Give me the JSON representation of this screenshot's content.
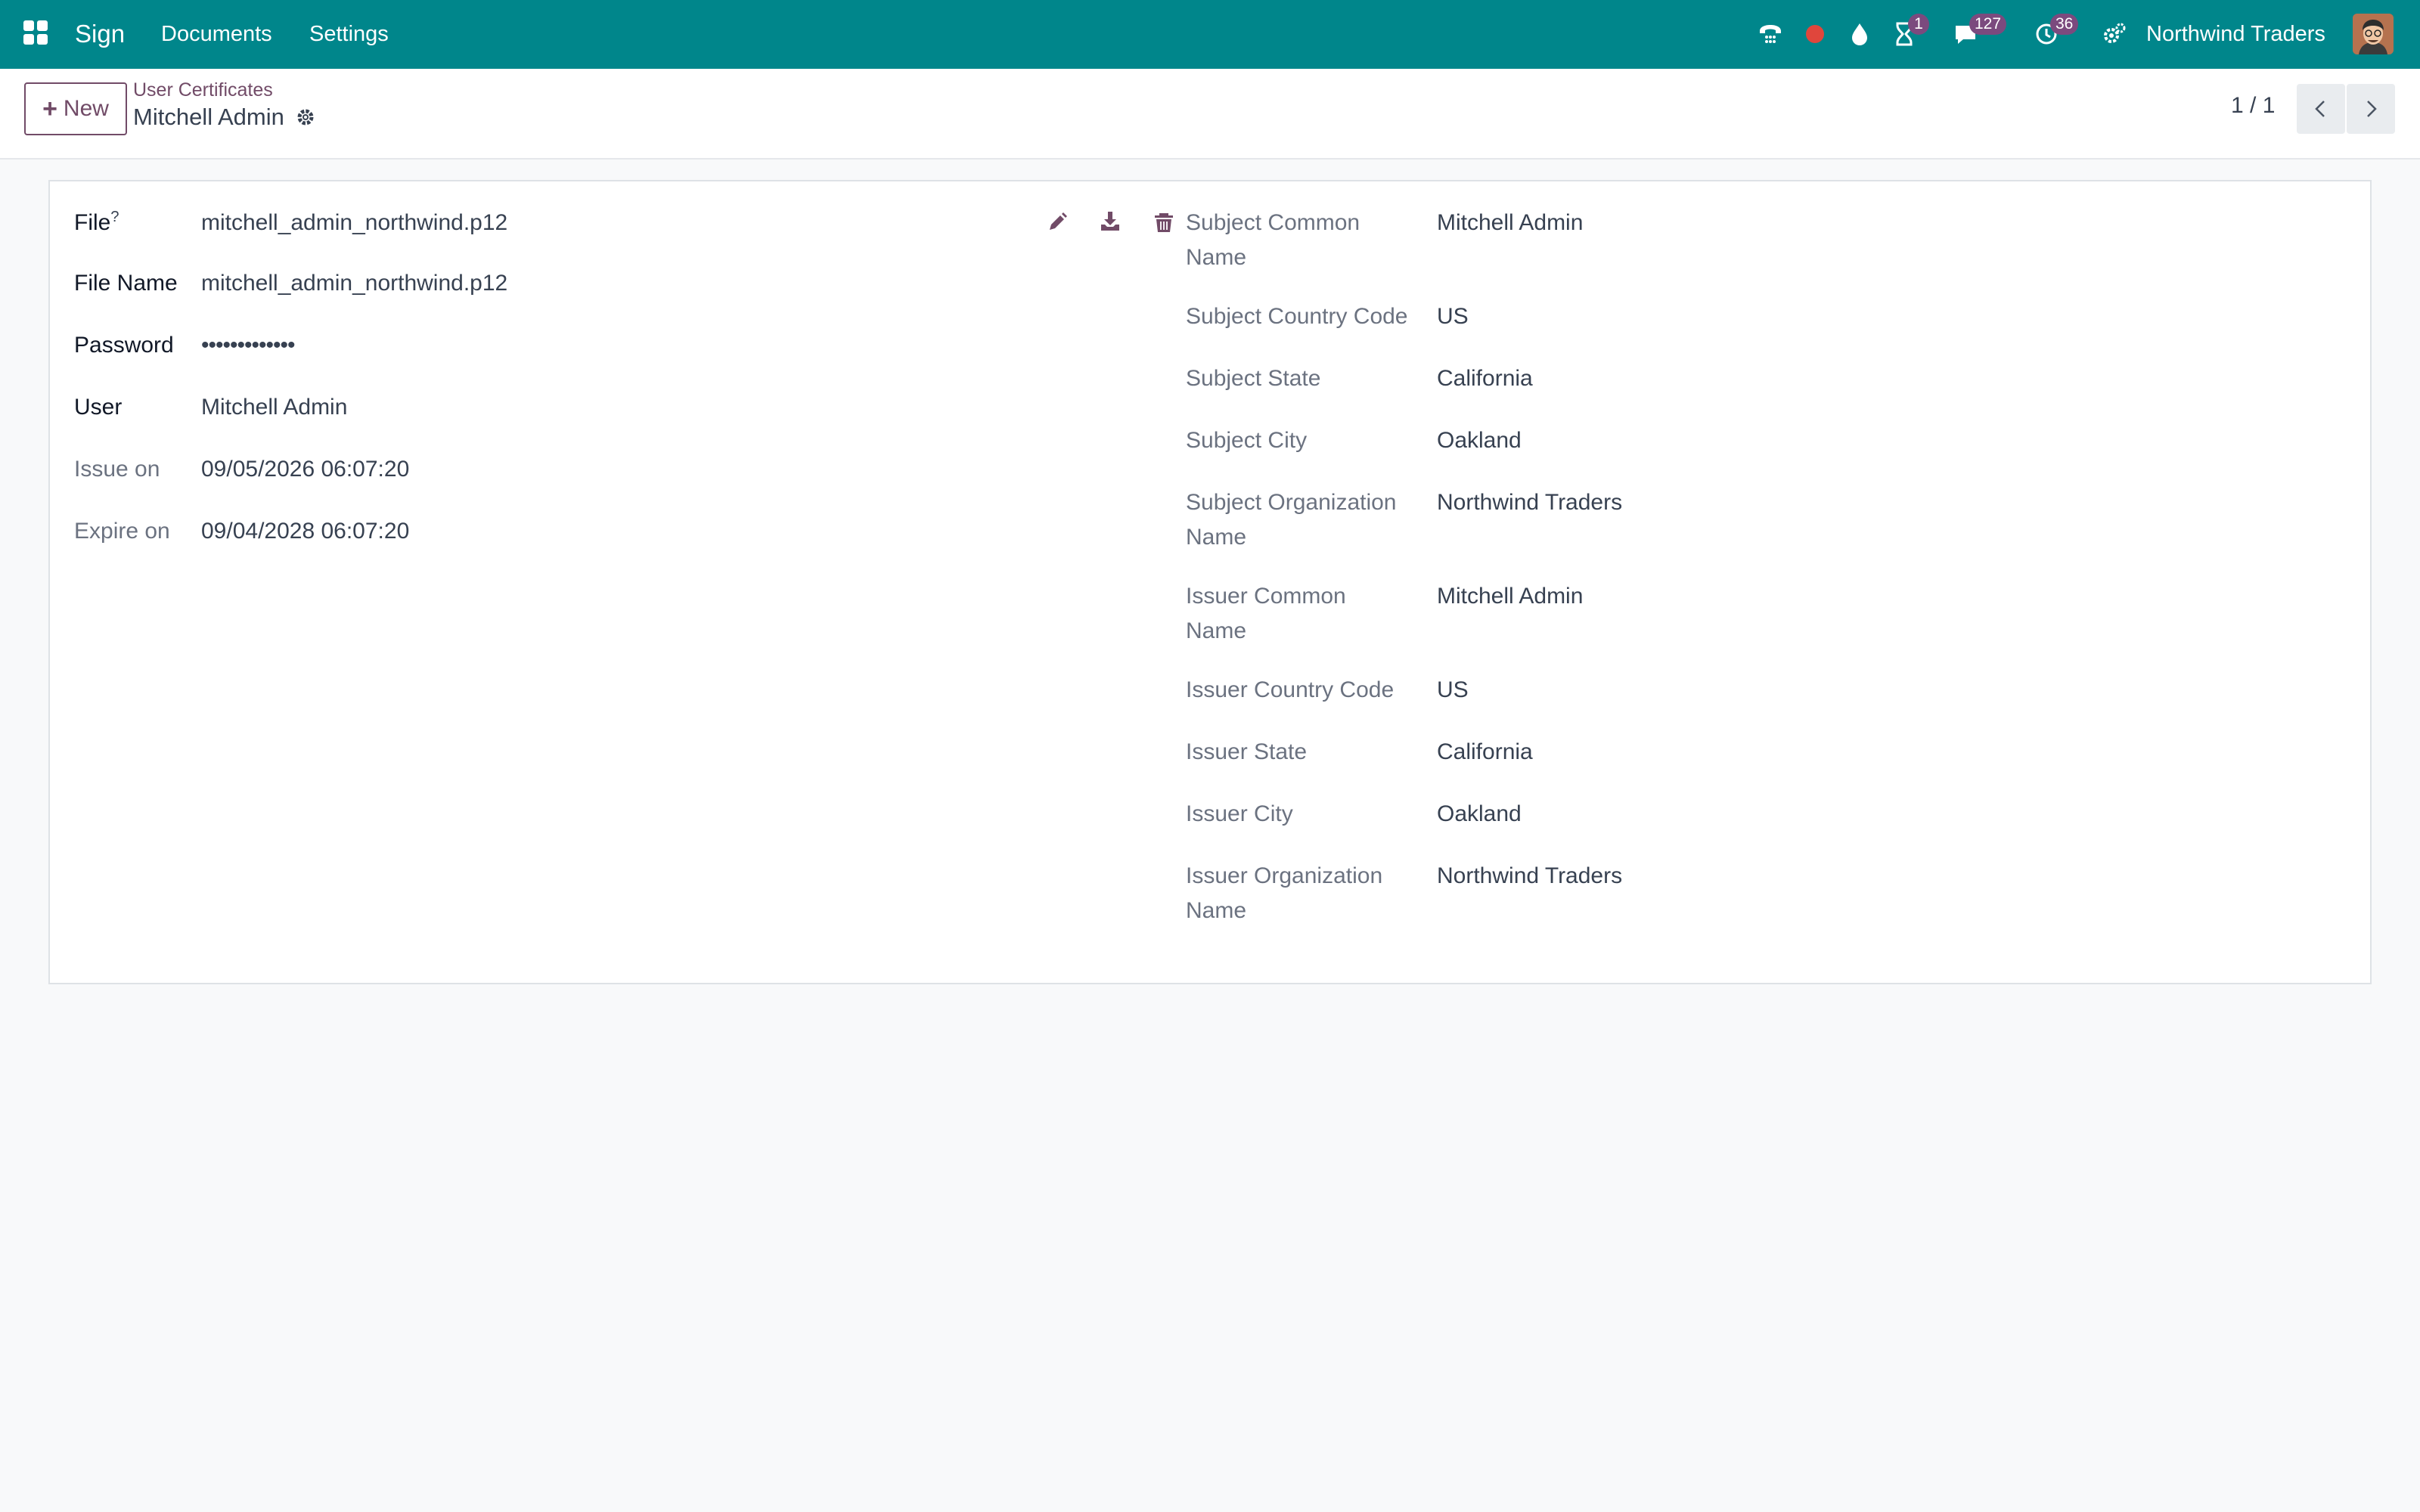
{
  "navbar": {
    "app_name": "Sign",
    "menu": [
      "Documents",
      "Settings"
    ],
    "icons": [
      "phone-icon",
      "record-icon",
      "drop-icon",
      "hourglass-icon",
      "chat-icon",
      "clock-icon",
      "settings-gears-icon"
    ],
    "badges": {
      "activities": "1",
      "messages": "127",
      "timesheet": "36"
    },
    "company": "Northwind Traders",
    "accent_color": "#00868b",
    "badge_color": "#7b4a7e",
    "record_dot_color": "#e0463c"
  },
  "control_panel": {
    "new_label": "New",
    "breadcrumb": "User Certificates",
    "title": "Mitchell Admin",
    "pager": "1 / 1"
  },
  "form": {
    "left": [
      {
        "label": "File",
        "help": "?",
        "value": "mitchell_admin_northwind.p12"
      },
      {
        "label": "File Name",
        "value": "mitchell_admin_northwind.p12"
      },
      {
        "label": "Password",
        "value": "•••••••••••••"
      },
      {
        "label": "User",
        "value": "Mitchell Admin"
      },
      {
        "label": "Issue on",
        "value": "09/05/2026 06:07:20"
      },
      {
        "label": "Expire on",
        "value": "09/04/2028 06:07:20"
      }
    ],
    "file_actions": [
      "edit-icon",
      "download-icon",
      "trash-icon"
    ],
    "right": [
      {
        "label": "Subject Common Name",
        "value": "Mitchell Admin"
      },
      {
        "label": "Subject Country Code",
        "value": "US"
      },
      {
        "label": "Subject State",
        "value": "California"
      },
      {
        "label": "Subject City",
        "value": "Oakland"
      },
      {
        "label": "Subject Organization Name",
        "value": "Northwind Traders"
      },
      {
        "label": "Issuer Common Name",
        "value": "Mitchell Admin"
      },
      {
        "label": "Issuer Country Code",
        "value": "US"
      },
      {
        "label": "Issuer State",
        "value": "California"
      },
      {
        "label": "Issuer City",
        "value": "Oakland"
      },
      {
        "label": "Issuer Organization Name",
        "value": "Northwind Traders"
      }
    ]
  }
}
